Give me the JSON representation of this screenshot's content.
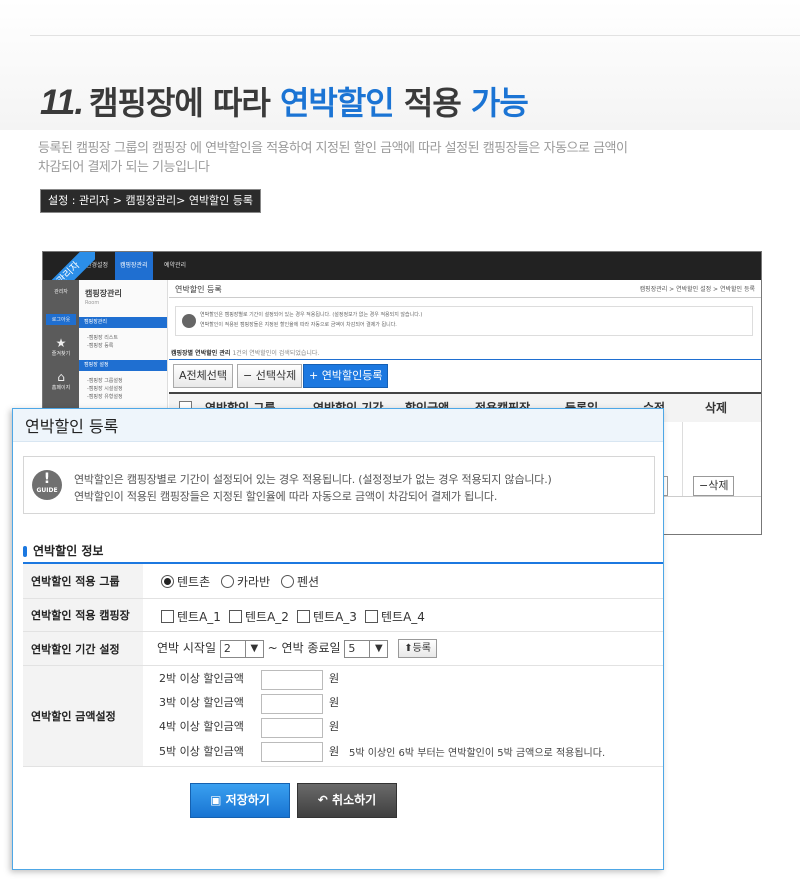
{
  "headline": {
    "num": "11.",
    "part1": "캠핑장에 따라",
    "part2": "연박할인",
    "part3": "적용",
    "part4": "가능"
  },
  "description": "등록된 캠핑장 그룹의 캠핑장 에 연박할인을 적용하여 지정된 할인 금액에 따라 설정된 캠핑장들은 자동으로 금액이 차감되어 결제가 되는 기능입니다",
  "path": "설정 : 관리자 > 캠핑장관리> 연박할인 등록",
  "background_screen": {
    "ribbon": "관리자",
    "top_tabs": [
      "환경설정",
      "캠핑장관리",
      "예약관리"
    ],
    "left_items": [
      "관리자",
      "로그아웃",
      "즐겨찾기",
      "홈페이지"
    ],
    "side_title": "캠핑장관리",
    "side_sub": "Room",
    "side_bar1": "캠핑장관리",
    "side_sub1": [
      "-캠핑장 리스트",
      "-캠핑장 등록"
    ],
    "side_bar2": "캠핑장 설정",
    "side_sub2": [
      "-캠핑장 그룹설정",
      "-캠핑장 시설설정",
      "-캠핑장 유형설정"
    ],
    "page_title": "연박할인 등록",
    "breadcrumb": "캠핑장관리 > 연박할인 설정 > 연박할인 등록",
    "guide_line1": "연박할인은 캠핑장별로 기간이 설정되어 있는 경우 적용됩니다. (설정정보가 없는 경우 적용되지 않습니다.)",
    "guide_line2": "연박할인이 적용된 캠핑장들은 지정된 할인율에 따라 자동으로 금액이 차감되어 결제가 됩니다.",
    "list_title": "캠핑장별 연박할인 관리",
    "list_count": "1건의 연박할인이 검색되었습니다.",
    "buttons": [
      "전체선택",
      "선택삭제",
      "연박할인등록"
    ],
    "table_headers": [
      "연박할인 그룹",
      "연박할인 기간",
      "할인금액",
      "적용캠핑장",
      "등록일",
      "수정",
      "삭제"
    ],
    "row_delete": "삭제"
  },
  "popup": {
    "title": "연박할인 등록",
    "guide_icon_text": "GUIDE",
    "guide_line1": "연박할인은 캠핑장별로 기간이 설정되어 있는 경우 적용됩니다. (설정정보가 없는 경우 적용되지 않습니다.)",
    "guide_line2": "연박할인이 적용된 캠핑장들은 지정된 할인율에 따라 자동으로 금액이 차감되어 결제가 됩니다.",
    "section_title": "연박할인 정보",
    "group_label": "연박할인 적용 그룹",
    "group_options": [
      "텐트촌",
      "카라반",
      "펜션"
    ],
    "group_selected": 0,
    "camp_label": "연박할인 적용 캠핑장",
    "camp_options": [
      "텐트A_1",
      "텐트A_2",
      "텐트A_3",
      "텐트A_4"
    ],
    "period_label": "연박할인 기간 설정",
    "period_start_label": "연박 시작일",
    "period_start_value": "2",
    "period_sep": "~ 연박 종료일",
    "period_end_value": "5",
    "period_button": "등록",
    "amount_label": "연박할인 금액설정",
    "amount_rows": [
      "2박 이상 할인금액",
      "3박 이상 할인금액",
      "4박 이상 할인금액",
      "5박 이상 할인금액"
    ],
    "won": "원",
    "amount_note": "5박 이상인 6박 부터는 연박할인이 5박 금액으로 적용됩니다.",
    "save_button": "저장하기",
    "cancel_button": "취소하기"
  }
}
